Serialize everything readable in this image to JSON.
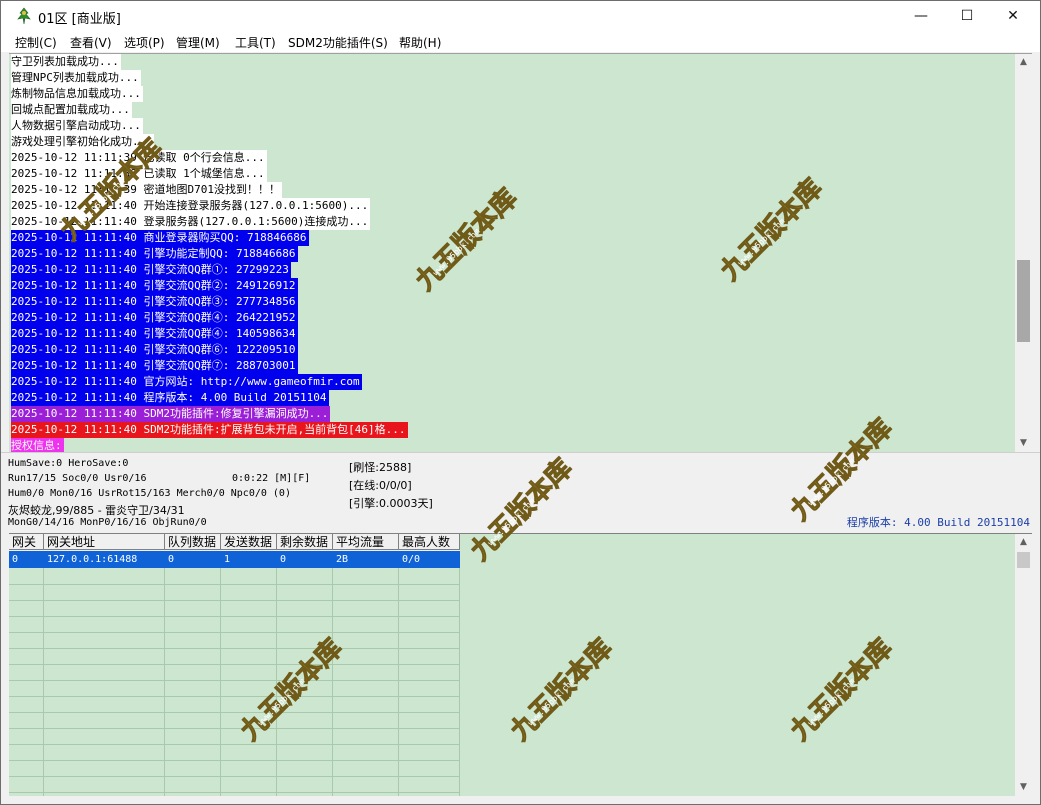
{
  "window": {
    "title": "01区 [商业版]",
    "controls": {
      "minimize": "—",
      "maximize": "☐",
      "close": "✕"
    }
  },
  "menu": [
    {
      "label": "控制(C)"
    },
    {
      "label": "查看(V)"
    },
    {
      "label": "选项(P)"
    },
    {
      "label": "管理(M)"
    },
    {
      "label": "工具(T)"
    },
    {
      "label": "SDM2功能插件(S)"
    },
    {
      "label": "帮助(H)"
    }
  ],
  "log": [
    {
      "text": "守卫列表加载成功...",
      "style": "plain"
    },
    {
      "text": "管理NPC列表加载成功...",
      "style": "plain"
    },
    {
      "text": "炼制物品信息加载成功...",
      "style": "plain"
    },
    {
      "text": "回城点配置加载成功...",
      "style": "plain"
    },
    {
      "text": "人物数据引擎启动成功...",
      "style": "plain"
    },
    {
      "text": "游戏处理引擎初始化成功...",
      "style": "plain"
    },
    {
      "text": "2025-10-12 11:11:39 已读取 0个行会信息...",
      "style": "plain"
    },
    {
      "text": "2025-10-12 11:11:39 已读取 1个城堡信息...",
      "style": "plain"
    },
    {
      "text": "2025-10-12 11:11:39 密道地图D701没找到！！！",
      "style": "plain"
    },
    {
      "text": "2025-10-12 11:11:40 开始连接登录服务器(127.0.0.1:5600)...",
      "style": "plain"
    },
    {
      "text": "2025-10-12 11:11:40 登录服务器(127.0.0.1:5600)连接成功...",
      "style": "plain"
    },
    {
      "text": "2025-10-12 11:11:40 商业登录器购买QQ: 718846686",
      "style": "blue"
    },
    {
      "text": "2025-10-12 11:11:40 引擎功能定制QQ: 718846686",
      "style": "blue"
    },
    {
      "text": "2025-10-12 11:11:40 引擎交流QQ群①: 27299223",
      "style": "blue"
    },
    {
      "text": "2025-10-12 11:11:40 引擎交流QQ群②: 249126912",
      "style": "blue"
    },
    {
      "text": "2025-10-12 11:11:40 引擎交流QQ群③: 277734856",
      "style": "blue"
    },
    {
      "text": "2025-10-12 11:11:40 引擎交流QQ群④: 264221952",
      "style": "blue"
    },
    {
      "text": "2025-10-12 11:11:40 引擎交流QQ群④: 140598634",
      "style": "blue"
    },
    {
      "text": "2025-10-12 11:11:40 引擎交流QQ群⑥: 122209510",
      "style": "blue"
    },
    {
      "text": "2025-10-12 11:11:40 引擎交流QQ群⑦: 288703001",
      "style": "blue"
    },
    {
      "text": "2025-10-12 11:11:40 官方网站: http://www.gameofmir.com",
      "style": "blue"
    },
    {
      "text": "2025-10-12 11:11:40 程序版本: 4.00 Build 20151104",
      "style": "blue"
    },
    {
      "text": "2025-10-12 11:11:40 SDM2功能插件:修复引擎漏洞成功...",
      "style": "purple"
    },
    {
      "text": "2025-10-12 11:11:40 SDM2功能插件:扩展背包未开启,当前背包[46]格...",
      "style": "red"
    },
    {
      "text": "授权信息:",
      "style": "magenta"
    }
  ],
  "status": {
    "line1": "HumSave:0 HeroSave:0",
    "line2": "Run17/15 Soc0/0 Usr0/16",
    "time": "0:0:22 [M][F]",
    "line3": "Hum0/0 Mon0/16 UsrRot15/163 Merch0/0 Npc0/0 (0)",
    "line4": "灰烬蛟龙,99/885 - 雷炎守卫/34/31",
    "line5": "MonG0/14/16 MonP0/16/16 ObjRun0/0",
    "refresh_mon": "[刷怪:2588]",
    "online": "[在线:0/0/0]",
    "engine": "[引擎:0.0003天]",
    "version": "程序版本: 4.00 Build 20151104"
  },
  "gateway_table": {
    "columns": [
      "网关",
      "网关地址",
      "队列数据",
      "发送数据",
      "剩余数据",
      "平均流量",
      "最高人数"
    ],
    "rows": [
      [
        "0",
        "127.0.0.1:61488",
        "0",
        "1",
        "0",
        "2B",
        "0/0"
      ]
    ]
  },
  "watermark": {
    "text": "九五版本库",
    "url": "www.95bbk.com"
  }
}
